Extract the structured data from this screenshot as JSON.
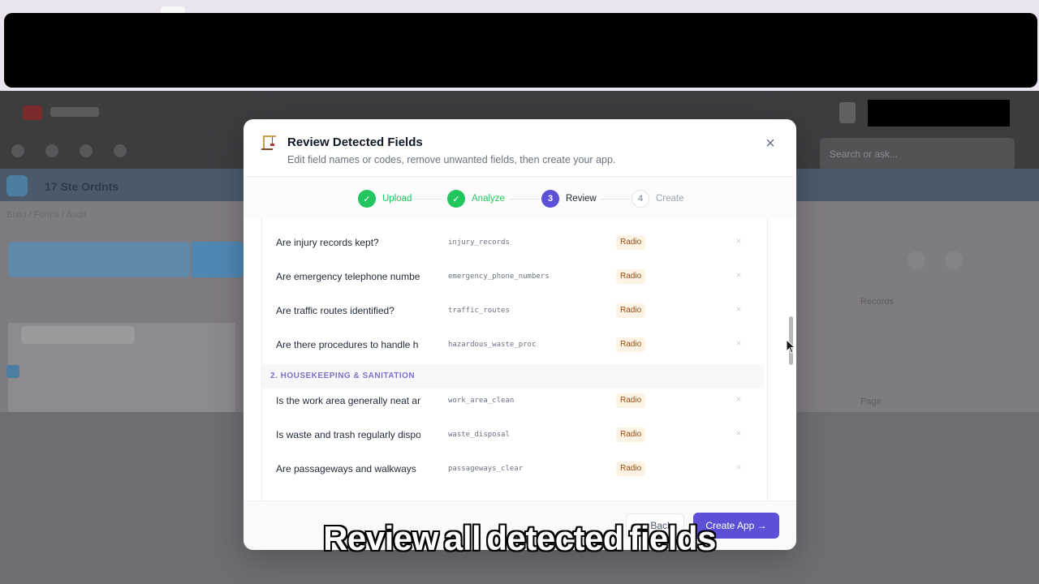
{
  "background_app": {
    "header_search_placeholder": "Search or ask...",
    "subheader_title": "17 Ste Ordnts",
    "breadcrumb": "Build / Forms / Audit",
    "right_label_1": "Records",
    "right_label_2": "Page"
  },
  "modal": {
    "title": "Review Detected Fields",
    "subtitle": "Edit field names or codes, remove unwanted fields, then create your app.",
    "close_label": "×",
    "steps": [
      {
        "number": "✓",
        "label": "Upload",
        "state": "done"
      },
      {
        "number": "✓",
        "label": "Analyze",
        "state": "done"
      },
      {
        "number": "3",
        "label": "Review",
        "state": "active"
      },
      {
        "number": "4",
        "label": "Create",
        "state": "todo"
      }
    ],
    "fields_before": [
      {
        "name": "Are injury records kept?",
        "code": "injury_records",
        "type": "Radio"
      },
      {
        "name": "Are emergency telephone numbe",
        "code": "emergency_phone_numbers",
        "type": "Radio"
      },
      {
        "name": "Are traffic routes identified?",
        "code": "traffic_routes",
        "type": "Radio"
      },
      {
        "name": "Are there procedures to handle h",
        "code": "hazardous_waste_proc",
        "type": "Radio"
      }
    ],
    "section_title": "2. HOUSEKEEPING & SANITATION",
    "fields_after": [
      {
        "name": "Is the work area generally neat ar",
        "code": "work_area_clean",
        "type": "Radio"
      },
      {
        "name": "Is waste and trash regularly dispo",
        "code": "waste_disposal",
        "type": "Radio"
      },
      {
        "name": "Are passageways and walkways",
        "code": "passageways_clear",
        "type": "Radio"
      }
    ],
    "remove_glyph": "×",
    "back_label": "← Back",
    "create_label": "Create App →"
  },
  "caption": "Review all detected fields",
  "colors": {
    "accent": "#5b50d6",
    "success": "#22c55e",
    "badge_text": "#9a4a10",
    "badge_bg": "#fdf3e4",
    "section_text": "#7b72c8"
  }
}
